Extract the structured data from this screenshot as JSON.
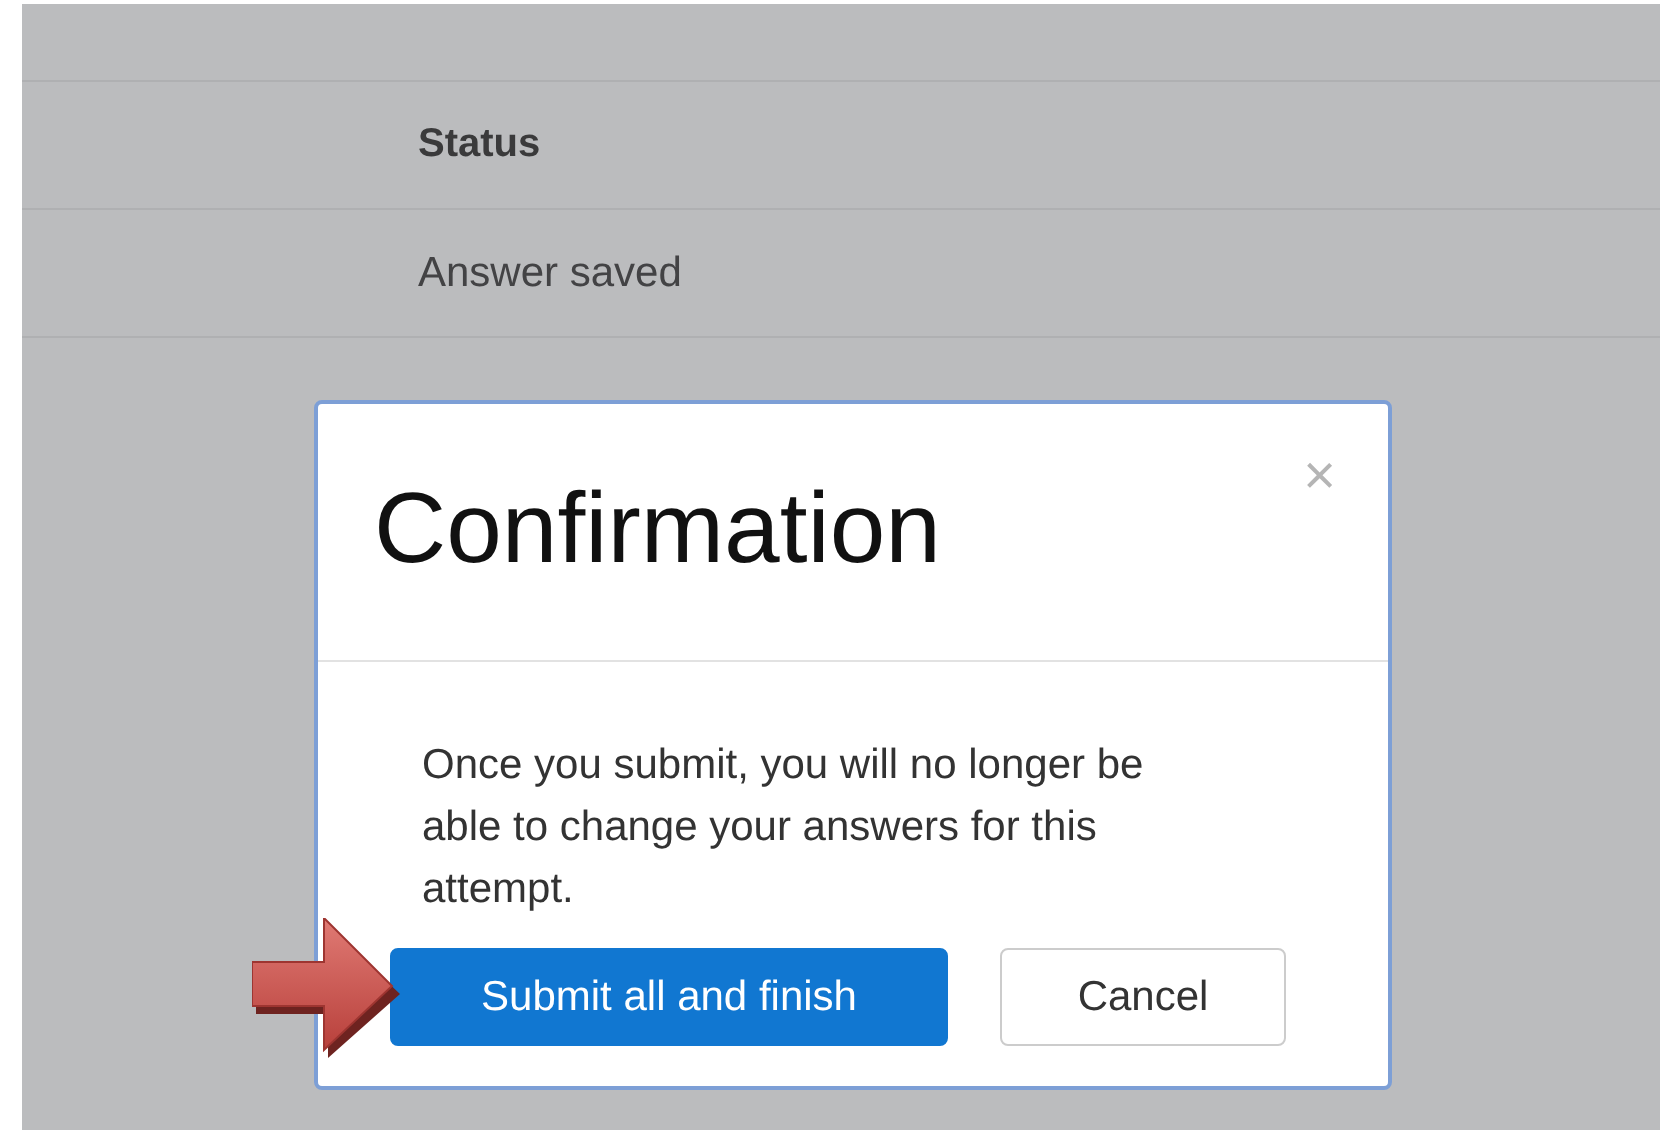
{
  "table": {
    "columns": [
      "Status"
    ],
    "rows": [
      {
        "status": "Answer saved"
      }
    ]
  },
  "dialog": {
    "title": "Confirmation",
    "close": "×",
    "message": "Once you submit, you will no longer be able to change your answers for this attempt.",
    "buttons": [
      {
        "label": "Submit all and finish",
        "kind": "primary"
      },
      {
        "label": "Cancel",
        "kind": "secondary"
      }
    ]
  }
}
